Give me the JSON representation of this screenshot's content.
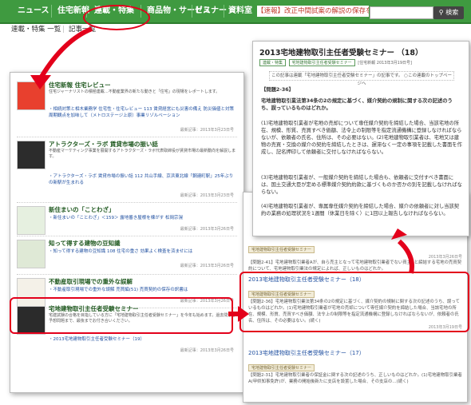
{
  "nav": {
    "items": [
      "ニュース",
      "住宅新報",
      "連載・特集",
      "商品物・サービス",
      "セミナー",
      "資料室"
    ],
    "ticker": "【速報】改正中間試案の解説の保存を開始し",
    "search_button": "検索"
  },
  "subnav": {
    "items": [
      "連載・特集 一覧",
      "記事一覧"
    ]
  },
  "left_entries": [
    {
      "title": "住宅新報 住宅レビュー",
      "text": "住宅ジャーナリストの積極連載…不動産業界の新たな動きと「住宅」の現場をレポートします。",
      "link": "・相続対策と相木業務学 住宅性・住宅レビュー 113 賃貸経営にも災害の備え 防災価値と対策周期観点を加味して（メトロステージ上原）事業リゾルベーション",
      "date": "最新記事：2013年3月23日号"
    },
    {
      "title": "アトラクターズ・ラボ 賃貸市場の振い話",
      "text": "不動産マーケティング事業を展開するアトラクターズ・ラボ代表取締役が賃貸市場の最新動向を解説します。",
      "link": "・アトラクターズ・ラボ 賃貸市場の振い話 112 共山手線、京浜東北線「鋼連町駅」25年ぶりの新駅が生まれる",
      "date": "最新記事：2013年3月23日号"
    },
    {
      "title": "新住まいの「ことわざ」",
      "text": "",
      "link": "・新住まいの「ことわざ」＜159＞ 露地番き屋根を棟がす 松岡宗滉",
      "date": "最新記事：2013年3月26日号"
    },
    {
      "title": "知って得する建物の豆知識",
      "text": "",
      "link": "・知って得する建物の豆知識 108 住宅の重さ 効果よく検査を済ませには",
      "date": "最新記事：2013年3月26日号"
    },
    {
      "title": "不動産取引現場での重外な誤解",
      "text": "",
      "link": "・不動産取引現場での重外な誤解 売買編(51) 売買契約の保存の訳書は",
      "date": "最新記事：2013年3月26日号"
    },
    {
      "title": "宅地建物取引主任者受験セミナー",
      "text": "宅建試験の合格を目指している方に「宅地建物取引主任者受験セミナー」を今年も始めます。過去問から予想問題まで、最後までお付き合いください。",
      "link": "・2013宅地建物取引主任者受験セミナー（19）",
      "date": "最新記事：2013年3月26日号"
    }
  ],
  "article": {
    "title": "2013宅地建物取引主任者受験セミナー （18）",
    "tags": [
      "連載・特集",
      "宅地建物取引主任者受験セミナー"
    ],
    "date_meta": "[住宅新報 2013年3月19日号]",
    "notice": "この記事は連載「宅地建物取引主任者受験セミナー」の記事です。 ○この連載のトップページへ",
    "question_head": "【問題2-36】",
    "question": "宅地建物取引業法第34条の2の規定に基づく、媒介契約の規制に関する次の記述のうち、誤っているものはどれか。",
    "options": [
      "(1)宅地建物取引業者が宅地の売却について専任媒介契約を締結した場合、当該宅地の所在、規模、形質、売買すべき価額、法令上の制限等を指定流通機構に登録しなければならないが、依頼者の氏名、住所は、その必要はない。(2)宅地建物取引業者は、宅地又は建物の売買・交換の媒介の契約を締結したときは、遅滞なく一定の事項を記載した書面を作成し、記名押印して依頼者に交付しなければならない。",
      "(3)宅地建物取引業者が、一般媒介契約を締結した場合も、依頼者に交付すべき書面には、国土交通大臣が定める標準媒介契約約款に基づくものか否かの別を記載しなければならない。",
      "(4)宅地建物取引業者が、専属専任媒介契約を締結した場合、媒介の依頼者に対し当該契約の業務の処理状況を1週間（休業日を除く）に1回以上報告しなければならない。"
    ]
  },
  "list": {
    "items": [
      {
        "tag": "宅地建物取引主任者受験セミナー",
        "title": "",
        "text": "【問題2-41】宅地建物取引業者Aが、自ら売主となって宅地建物取引業者でない買主Bと締結する宅地の売買契約について、宅地建物取引業法の規定によれば、正しいものはどれか。",
        "date": "2013年3月26日号"
      },
      {
        "tag": "宅地建物取引主任者受験セミナー",
        "title": "2013宅地建物取引主任者受験セミナー（18）",
        "text": "【問題2-36】宅地建物取引業法第34条の2の規定に基づく、媒介契約の規制に関する次の記述のうち、誤っているものはどれか。(1)宅地建物取引業者が宅地の売却について専任媒介契約を締結した場合、当該宅地の所在、規模、形質、売買すべき価額、法令上の制限等を指定流通機構に登録しなければならないが、依頼者の氏名、住所は、その必要はない。(続く)",
        "date": "2013年3月19日号"
      },
      {
        "tag": "宅地建物取引主任者受験セミナー",
        "title": "2013宅地建物取引主任者受験セミナー（17）",
        "text": "【問題2-31】宅地建物取引業者の保証金に関する次の記述のうち、正しいものはどれか。(1)宅地建物取引業者A(甲県知事免許)が、業務の開始後新たに支店を設置した場合、その支店の…(続く)",
        "date": ""
      }
    ]
  },
  "colors": {
    "nav_green": "#3f9a40",
    "highlight_red": "#e3001b",
    "link_blue": "#1f4fa0"
  }
}
